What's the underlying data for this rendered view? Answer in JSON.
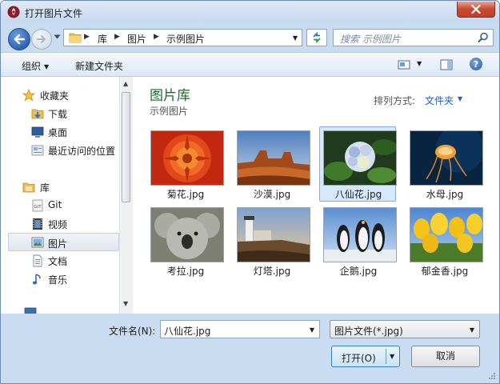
{
  "window": {
    "title": "打开图片文件",
    "close_icon": "close-icon"
  },
  "nav": {
    "breadcrumbs": [
      "库",
      "图片",
      "示例图片"
    ],
    "search_placeholder": "搜索 示例图片"
  },
  "toolbar": {
    "organize_label": "组织",
    "new_folder_label": "新建文件夹"
  },
  "sidebar": {
    "items": [
      {
        "label": "收藏夹",
        "icon": "star-icon"
      },
      {
        "label": "下载",
        "icon": "download-folder-icon"
      },
      {
        "label": "桌面",
        "icon": "desktop-icon"
      },
      {
        "label": "最近访问的位置",
        "icon": "recent-places-icon"
      },
      {
        "label": "库",
        "icon": "library-icon"
      },
      {
        "label": "Git",
        "icon": "git-icon"
      },
      {
        "label": "视频",
        "icon": "video-icon"
      },
      {
        "label": "图片",
        "icon": "pictures-icon",
        "selected": true
      },
      {
        "label": "文档",
        "icon": "documents-icon"
      },
      {
        "label": "音乐",
        "icon": "music-icon"
      }
    ]
  },
  "library": {
    "title": "图片库",
    "subtitle": "示例图片",
    "arrange_label": "排列方式:",
    "arrange_value": "文件夹"
  },
  "files": [
    {
      "name": "菊花.jpg"
    },
    {
      "name": "沙漠.jpg"
    },
    {
      "name": "八仙花.jpg",
      "selected": true
    },
    {
      "name": "水母.jpg"
    },
    {
      "name": "考拉.jpg"
    },
    {
      "name": "灯塔.jpg"
    },
    {
      "name": "企鹅.jpg"
    },
    {
      "name": "郁金香.jpg"
    }
  ],
  "footer": {
    "filename_label": "文件名(N):",
    "filename_value": "八仙花.jpg",
    "filetype_value": "图片文件(*.jpg)",
    "open_label": "打开(O)",
    "cancel_label": "取消"
  },
  "colors": {
    "library_title": "#1e6a29",
    "link_blue": "#1f5fbf",
    "selection": "#d6e8fb"
  }
}
